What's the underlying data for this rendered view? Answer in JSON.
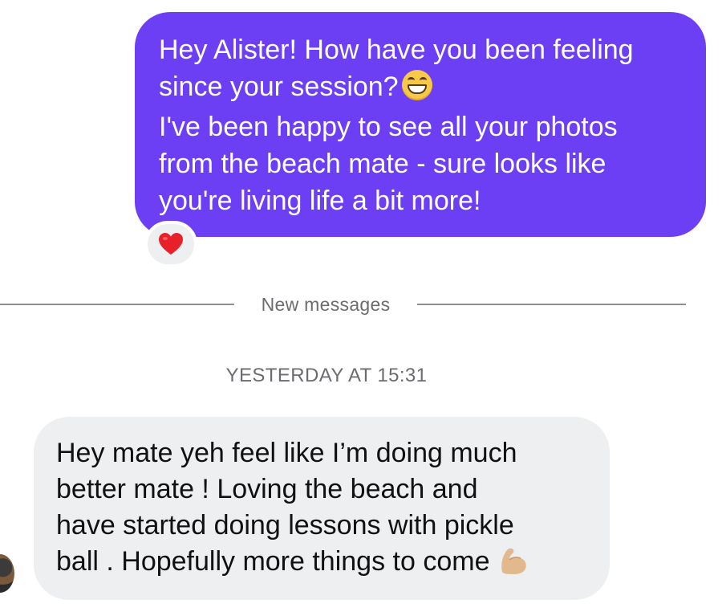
{
  "outgoing_message": {
    "lines": [
      "Hey Alister! How have you been feeling",
      "since your session?",
      "I've been happy to see all your photos",
      "from the beach mate - sure looks like",
      "you're living life a bit more!"
    ],
    "inline_emoji": "grinning-face-icon",
    "bubble_color": "#6c3ff5",
    "reaction": {
      "icon": "red-heart-icon",
      "color": "#e8202a"
    }
  },
  "divider": {
    "label": "New messages"
  },
  "timestamp": {
    "text": "YESTERDAY AT 15:31"
  },
  "incoming_message": {
    "lines": [
      "Hey mate yeh feel like I’m doing much",
      "better mate ! Loving the beach and",
      "have started doing lessons with pickle",
      "ball . Hopefully more things to come"
    ],
    "inline_emoji": "flexed-biceps-icon",
    "bubble_color": "#eeeff1"
  }
}
